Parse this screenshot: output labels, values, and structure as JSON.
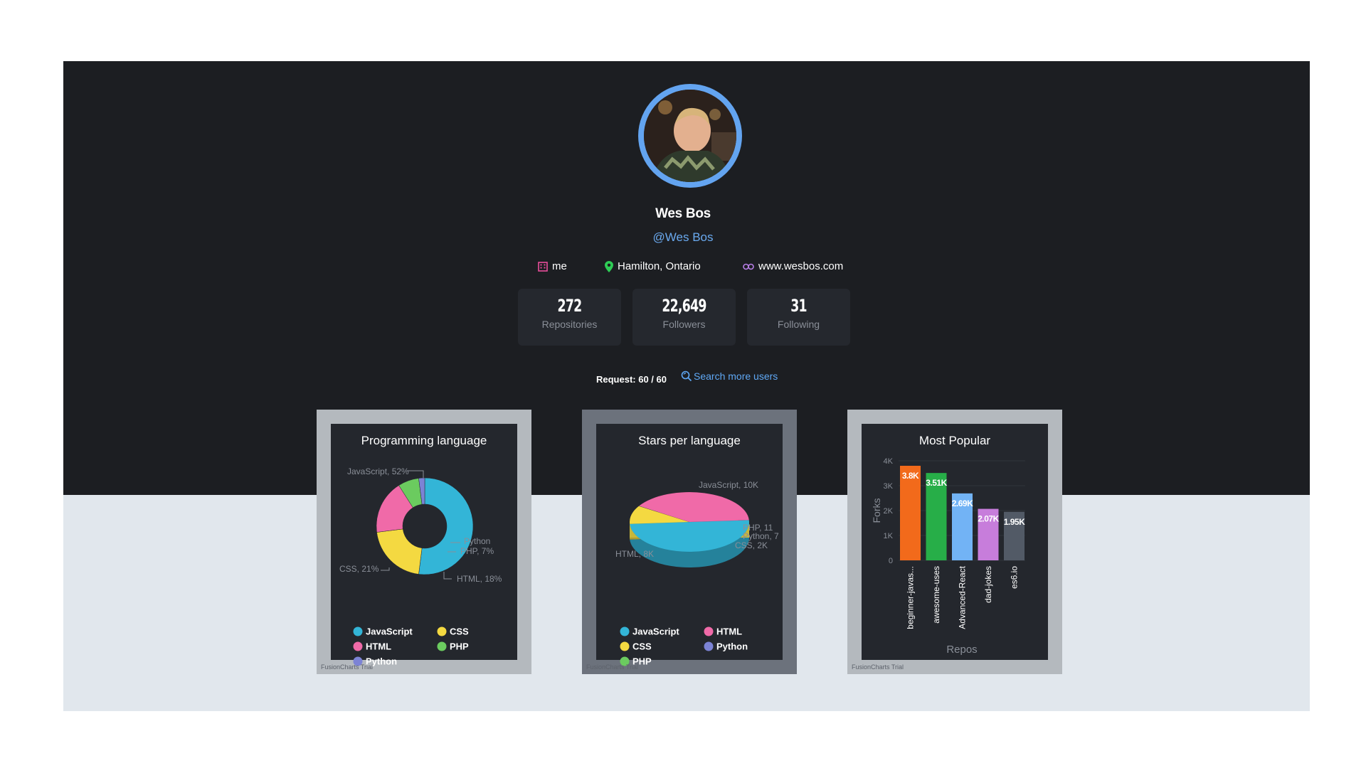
{
  "profile": {
    "name": "Wes Bos",
    "handle": "@Wes Bos",
    "company": "me",
    "location": "Hamilton, Ontario",
    "website": "www.wesbos.com"
  },
  "stats": [
    {
      "value": "272",
      "label": "Repositories"
    },
    {
      "value": "22,649",
      "label": "Followers"
    },
    {
      "value": "31",
      "label": "Following"
    }
  ],
  "request": {
    "label": "Request: 60 / 60"
  },
  "search": {
    "label": "Search more users",
    "icon": "search-icon"
  },
  "colors": {
    "javascript": "#33b5d7",
    "css": "#f4d941",
    "html": "#f06aa8",
    "php": "#6bcb5f",
    "python": "#7c83d5"
  },
  "trial_text": "FusionCharts Trial",
  "chart_data": [
    {
      "type": "pie",
      "variant": "doughnut",
      "title": "Programming language",
      "labels": [
        "JavaScript",
        "CSS",
        "HTML",
        "PHP",
        "Python"
      ],
      "slice_labels": [
        "JavaScript, 52%",
        "CSS, 21%",
        "HTML, 18%",
        "PHP, 7%",
        "Python"
      ],
      "values": [
        52,
        21,
        18,
        7,
        2
      ],
      "legend": [
        "JavaScript",
        "CSS",
        "HTML",
        "PHP",
        "Python"
      ]
    },
    {
      "type": "pie",
      "variant": "3d",
      "title": "Stars per language",
      "labels": [
        "JavaScript",
        "HTML",
        "CSS",
        "Python",
        "PHP"
      ],
      "slice_labels": [
        "JavaScript, 10K",
        "HTML, 8K",
        "CSS, 2K",
        "Python, 7",
        "PHP, 11"
      ],
      "values": [
        10000,
        8000,
        2000,
        7,
        11
      ],
      "legend": [
        "JavaScript",
        "HTML",
        "CSS",
        "Python",
        "PHP"
      ]
    },
    {
      "type": "bar",
      "title": "Most Popular",
      "categories": [
        "beginner-javas...",
        "awesome-uses",
        "Advanced-React",
        "dad-jokes",
        "es6.io"
      ],
      "values": [
        3800,
        3510,
        2690,
        2070,
        1950
      ],
      "value_labels": [
        "3.8K",
        "3.51K",
        "2.69K",
        "2.07K",
        "1.95K"
      ],
      "colors": [
        "#f26a1b",
        "#27ae48",
        "#72b3f5",
        "#c77ddb",
        "#525a66"
      ],
      "xlabel": "Repos",
      "ylabel": "Forks",
      "yticks": [
        "0",
        "1K",
        "2K",
        "3K",
        "4K"
      ],
      "ylim": [
        0,
        4000
      ]
    }
  ]
}
